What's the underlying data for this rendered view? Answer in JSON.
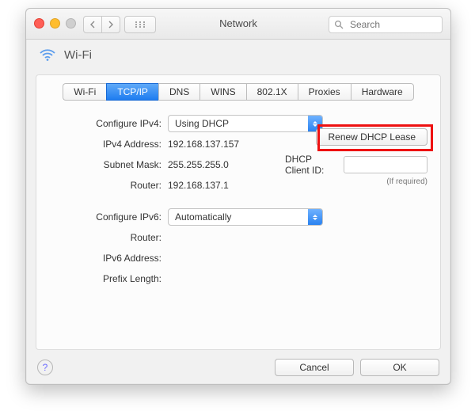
{
  "window": {
    "title": "Network",
    "search_placeholder": "Search"
  },
  "header": {
    "interface": "Wi-Fi"
  },
  "tabs": [
    "Wi-Fi",
    "TCP/IP",
    "DNS",
    "WINS",
    "802.1X",
    "Proxies",
    "Hardware"
  ],
  "selected_tab": "TCP/IP",
  "ipv4": {
    "configure_label": "Configure IPv4:",
    "configure_value": "Using DHCP",
    "address_label": "IPv4 Address:",
    "address_value": "192.168.137.157",
    "subnet_label": "Subnet Mask:",
    "subnet_value": "255.255.255.0",
    "router_label": "Router:",
    "router_value": "192.168.137.1"
  },
  "dhcp": {
    "renew_label": "Renew DHCP Lease",
    "client_id_label": "DHCP Client ID:",
    "client_id_value": "",
    "if_required": "(If required)"
  },
  "ipv6": {
    "configure_label": "Configure IPv6:",
    "configure_value": "Automatically",
    "router_label": "Router:",
    "router_value": "",
    "address_label": "IPv6 Address:",
    "address_value": "",
    "prefix_label": "Prefix Length:",
    "prefix_value": ""
  },
  "footer": {
    "cancel": "Cancel",
    "ok": "OK"
  },
  "annotation": {
    "highlight_target": "renew-dhcp-lease-button",
    "color": "#e11"
  }
}
